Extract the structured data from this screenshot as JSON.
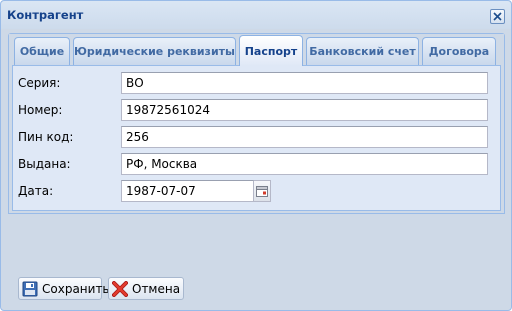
{
  "window": {
    "title": "Контрагент",
    "close_icon": "close-icon"
  },
  "tabs": [
    {
      "label": "Общие",
      "active": false
    },
    {
      "label": "Юридические реквизиты",
      "active": false
    },
    {
      "label": "Паспорт",
      "active": true
    },
    {
      "label": "Банковский счет",
      "active": false
    },
    {
      "label": "Договора",
      "active": false
    }
  ],
  "form": {
    "series": {
      "label": "Серия:",
      "value": "ВО"
    },
    "number": {
      "label": "Номер:",
      "value": "19872561024"
    },
    "pin": {
      "label": "Пин код:",
      "value": "256"
    },
    "issued": {
      "label": "Выдана:",
      "value": "РФ, Москва"
    },
    "date": {
      "label": "Дата:",
      "value": "1987-07-07",
      "icon": "calendar-icon"
    }
  },
  "buttons": {
    "save": {
      "label": "Сохранить",
      "icon": "floppy-disk-icon"
    },
    "cancel": {
      "label": "Отмена",
      "icon": "red-x-icon"
    }
  },
  "colors": {
    "title_text": "#15428b",
    "window_bg": "#ced9e7",
    "form_bg": "#dfe8f6",
    "border": "#99bbe8"
  }
}
